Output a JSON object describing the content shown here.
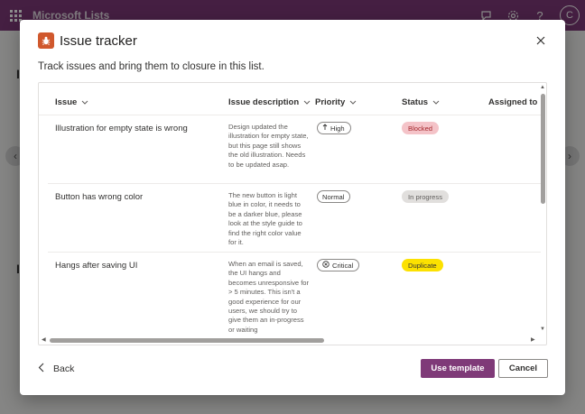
{
  "app": {
    "title": "Microsoft Lists",
    "avatar_initial": "C",
    "brand_color": "#7f3a78"
  },
  "background": {
    "letters": [
      "I",
      "I"
    ]
  },
  "dialog": {
    "title": "Issue tracker",
    "subtitle": "Track issues and bring them to closure in this list.",
    "icon": "bug-icon",
    "icon_color": "#d0582d",
    "columns": [
      "Issue",
      "Issue description",
      "Priority",
      "Status",
      "Assigned to"
    ],
    "rows": [
      {
        "issue": "Illustration for empty state is wrong",
        "description": "Design updated the illustration for empty state, but this page still shows the old illustration. Needs to be updated asap.",
        "priority": "High",
        "priority_icon": "arrow-up-icon",
        "status": "Blocked",
        "status_bg": "#f4c3c8",
        "status_fg": "#a4262c"
      },
      {
        "issue": "Button has wrong color",
        "description": "The new button is light blue in color, it needs to be a darker blue, please look at the style guide to find the right color value for it.",
        "priority": "Normal",
        "priority_icon": "",
        "status": "In progress",
        "status_bg": "#e1dfdd",
        "status_fg": "#605e5c"
      },
      {
        "issue": "Hangs after saving UI",
        "description": "When an email is saved, the UI hangs and becomes unresponsive for > 5 minutes. This isn't a good experience for our users, we should try to give them an in-progress or waiting",
        "priority": "Critical",
        "priority_icon": "x-circle-icon",
        "status": "Duplicate",
        "status_bg": "#fce100",
        "status_fg": "#323130"
      }
    ],
    "footer": {
      "back_label": "Back",
      "use_label": "Use template",
      "cancel_label": "Cancel"
    }
  }
}
